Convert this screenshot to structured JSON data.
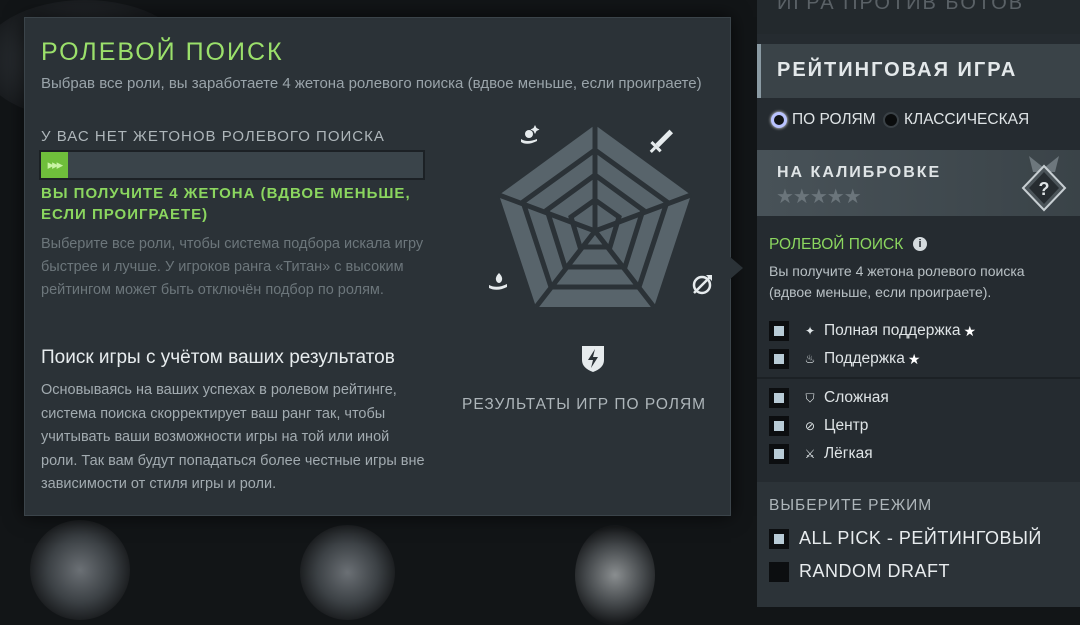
{
  "tooltip": {
    "title": "РОЛЕВОЙ ПОИСК",
    "subtitle": "Выбрав все роли, вы заработаете 4 жетона ролевого поиска (вдвое меньше, если проиграете)",
    "no_tokens": "У ВАС НЕТ ЖЕТОНОВ РОЛЕВОГО ПОИСКА",
    "token_progress": 0.07,
    "earn_text": "ВЫ ПОЛУЧИТЕ 4 ЖЕТОНА (ВДВОЕ МЕНЬШЕ, ЕСЛИ ПРОИГРАЕТЕ)",
    "select_roles_text": "Выберите все роли, чтобы система подбора искала игру быстрее и лучше. У игроков ранга «Титан» с высоким рейтингом может быть отключён подбор по ролям.",
    "search_heading": "Поиск игры с учётом ваших результатов",
    "search_desc": "Основываясь на ваших успехах в ролевом рейтинге, система поиска скорректирует ваш ранг так, чтобы учитывать ваши возможности игры на той или иной роли. Так вам будут попадаться более честные игры вне зависимости от стиля игры и роли.",
    "radar_caption": "РЕЗУЛЬТАТЫ ИГР ПО РОЛЯМ",
    "radar_icons": [
      "hard-support-icon",
      "carry-sword-icon",
      "offlane-icon",
      "mid-icon",
      "soft-support-icon"
    ]
  },
  "right_panel": {
    "bots_label": "ИГРА ПРОТИВ БОТОВ",
    "ranked_title": "РЕЙТИНГОВАЯ ИГРА",
    "radio_options": [
      {
        "label": "ПО РОЛЯМ",
        "selected": true
      },
      {
        "label": "КЛАССИЧЕСКАЯ",
        "selected": false
      }
    ],
    "calibration_label": "НА КАЛИБРОВКЕ",
    "calibration_stars": "★★★★★",
    "rank_badge_glyph": "?",
    "role_search_title": "РОЛЕВОЙ ПОИСК",
    "role_search_desc": "Вы получите 4 жетона ролевого поиска (вдвое меньше, если проиграете).",
    "roles_support": [
      {
        "label": "Полная поддержка",
        "checked": true,
        "icon": "hard-support-icon",
        "starred": true
      },
      {
        "label": "Поддержка",
        "checked": true,
        "icon": "support-icon",
        "starred": true
      }
    ],
    "roles_core": [
      {
        "label": "Сложная",
        "checked": true,
        "icon": "offlane-shield-icon"
      },
      {
        "label": "Центр",
        "checked": true,
        "icon": "mid-icon"
      },
      {
        "label": "Лёгкая",
        "checked": true,
        "icon": "carry-icon"
      }
    ],
    "mode_title": "ВЫБЕРИТЕ РЕЖИМ",
    "modes": [
      {
        "label": "ALL PICK - РЕЙТИНГОВЫЙ",
        "checked": true
      },
      {
        "label": "RANDOM DRAFT",
        "checked": false
      }
    ],
    "colors": {
      "accent_green": "#8bd65f",
      "panel": "#252b30",
      "tooltip_bg": "#2b3237"
    }
  }
}
